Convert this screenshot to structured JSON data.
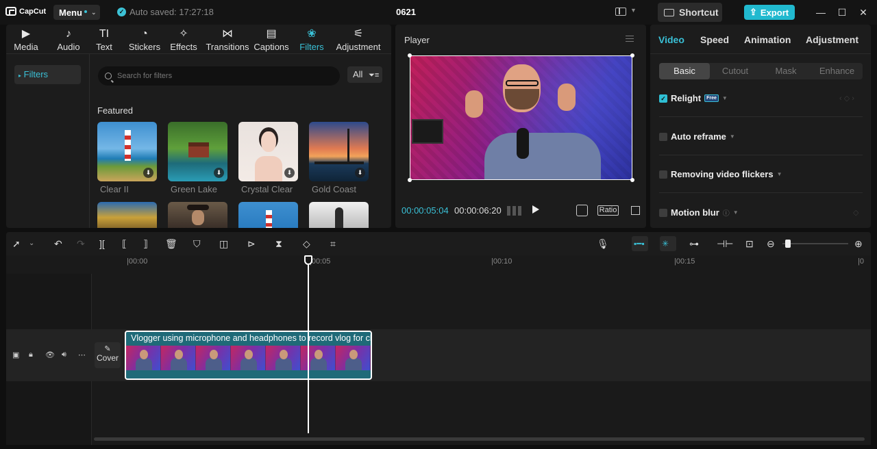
{
  "titlebar": {
    "app_name": "CapCut",
    "menu_label": "Menu",
    "autosave": "Auto saved: 17:27:18",
    "project_title": "0621",
    "shortcut_label": "Shortcut",
    "export_label": "Export",
    "minimize": "—",
    "maximize": "☐",
    "close": "✕"
  },
  "toolbar_tabs": [
    {
      "label": "Media",
      "icon": "media-icon",
      "glyph": "▶"
    },
    {
      "label": "Audio",
      "icon": "audio-icon",
      "glyph": "♪"
    },
    {
      "label": "Text",
      "icon": "text-icon",
      "glyph": "TI"
    },
    {
      "label": "Stickers",
      "icon": "stickers-icon",
      "glyph": "◔"
    },
    {
      "label": "Effects",
      "icon": "effects-icon",
      "glyph": "✧"
    },
    {
      "label": "Transitions",
      "icon": "transitions-icon",
      "glyph": "⋈"
    },
    {
      "label": "Captions",
      "icon": "captions-icon",
      "glyph": "▤"
    },
    {
      "label": "Filters",
      "icon": "filters-icon",
      "glyph": "❀"
    },
    {
      "label": "Adjustment",
      "icon": "adjustment-icon",
      "glyph": "⚟"
    }
  ],
  "active_tab": "Filters",
  "filters_panel": {
    "sidebar_item": "Filters",
    "search_placeholder": "Search for filters",
    "all_label": "All",
    "section_title": "Featured",
    "items": [
      {
        "label": "Clear II"
      },
      {
        "label": "Green Lake"
      },
      {
        "label": "Crystal Clear"
      },
      {
        "label": "Gold Coast"
      }
    ]
  },
  "player": {
    "title": "Player",
    "current_time": "00:00:05:04",
    "total_time": "00:00:06:20",
    "ratio_label": "Ratio"
  },
  "inspector": {
    "tabs": [
      "Video",
      "Speed",
      "Animation",
      "Adjustment"
    ],
    "active_tab": "Video",
    "subtabs": [
      "Basic",
      "Cutout",
      "Mask",
      "Enhance"
    ],
    "active_subtab": "Basic",
    "options": [
      {
        "label": "Relight",
        "checked": true,
        "badge": "Free"
      },
      {
        "label": "Auto reframe",
        "checked": false
      },
      {
        "label": "Removing video flickers",
        "checked": false
      },
      {
        "label": "Motion blur",
        "checked": false
      }
    ]
  },
  "timeline": {
    "ruler": [
      "|00:00",
      "|00:05",
      "|00:10",
      "|00:15",
      "|0"
    ],
    "cover_label": "Cover",
    "clip_title": "Vlogger using microphone and headphones to record vlog for cha"
  },
  "colors": {
    "accent": "#3ac1d7",
    "export_bg": "#21b9cf",
    "clip_bg": "#1f6a78"
  }
}
